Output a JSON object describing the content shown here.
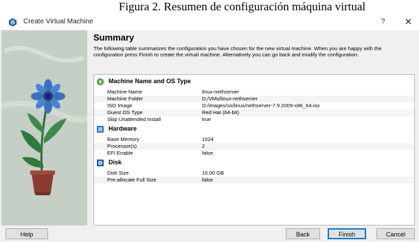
{
  "caption": "Figura 2. Resumen de configuración máquina virtual",
  "window": {
    "title": "Create Virtual Machine",
    "help_glyph": "?",
    "close_glyph": "✕"
  },
  "summary": {
    "title": "Summary",
    "description": "The following table summarizes the configuration you have chosen for the new virtual machine. When you are happy with the configuration press Finish to create the virtual machine. Alternatively you can go back and modify the configuration."
  },
  "groups": [
    {
      "label": "Machine Name and OS Type",
      "icon": "machine-os-icon",
      "rows": [
        {
          "key": "Machine Name",
          "value": "linux-nethserver"
        },
        {
          "key": "Machine Folder",
          "value": "D:/VMs/linux-nethserver"
        },
        {
          "key": "ISO Image",
          "value": "D:/images/so/linux/nethserver-7.9.2009-x86_64.iso"
        },
        {
          "key": "Guest OS Type",
          "value": "Red Hat (64-bit)"
        },
        {
          "key": "Skip Unattended Install",
          "value": "true"
        }
      ]
    },
    {
      "label": "Hardware",
      "icon": "hardware-chip-icon",
      "rows": [
        {
          "key": "Base Memory",
          "value": "1024"
        },
        {
          "key": "Processor(s)",
          "value": "2"
        },
        {
          "key": "EFI Enable",
          "value": "false"
        }
      ]
    },
    {
      "label": "Disk",
      "icon": "disk-icon",
      "rows": [
        {
          "key": "Disk Size",
          "value": "10.00 GB"
        },
        {
          "key": "Pre-allocate Full Size",
          "value": "false"
        }
      ]
    }
  ],
  "buttons": {
    "help": "Help",
    "back": "Back",
    "finish": "Finish",
    "cancel": "Cancel"
  }
}
